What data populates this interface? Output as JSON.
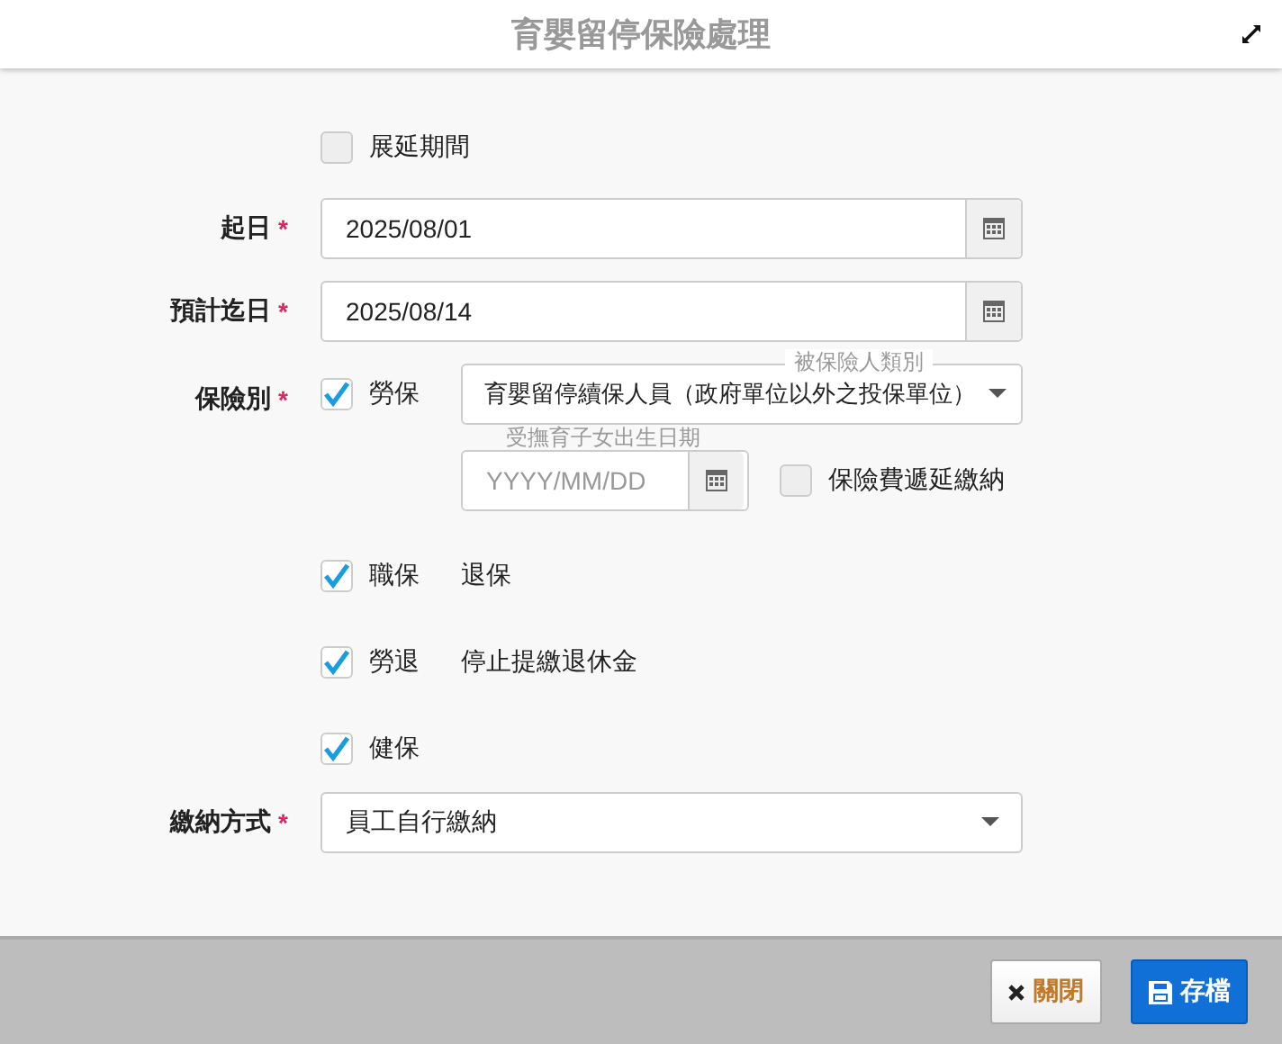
{
  "window": {
    "title": "育嬰留停保險處理"
  },
  "extend_period": {
    "label": "展延期間",
    "checked": false
  },
  "start_date": {
    "label": "起日",
    "required_mark": "*",
    "value": "2025/08/01"
  },
  "end_date": {
    "label": "預計迄日",
    "required_mark": "*",
    "value": "2025/08/14"
  },
  "insurance": {
    "label": "保險別",
    "required_mark": "*",
    "labor": {
      "label": "勞保",
      "checked": true,
      "category": {
        "legend": "被保險人類別",
        "value": "育嬰留停續保人員（政府單位以外之投保單位）"
      },
      "birth_date": {
        "legend": "受撫育子女出生日期",
        "placeholder": "YYYY/MM/DD"
      },
      "deferral": {
        "label": "保險費遞延繳納",
        "checked": false
      }
    },
    "others": [
      {
        "label": "職保",
        "checked": true,
        "note": "退保"
      },
      {
        "label": "勞退",
        "checked": true,
        "note": "停止提繳退休金"
      },
      {
        "label": "健保",
        "checked": true
      }
    ]
  },
  "payment": {
    "label": "繳納方式",
    "required_mark": "*",
    "value": "員工自行繳納"
  },
  "buttons": [
    {
      "kind": "close",
      "label": "關閉"
    },
    {
      "kind": "save",
      "label": "存檔"
    }
  ]
}
